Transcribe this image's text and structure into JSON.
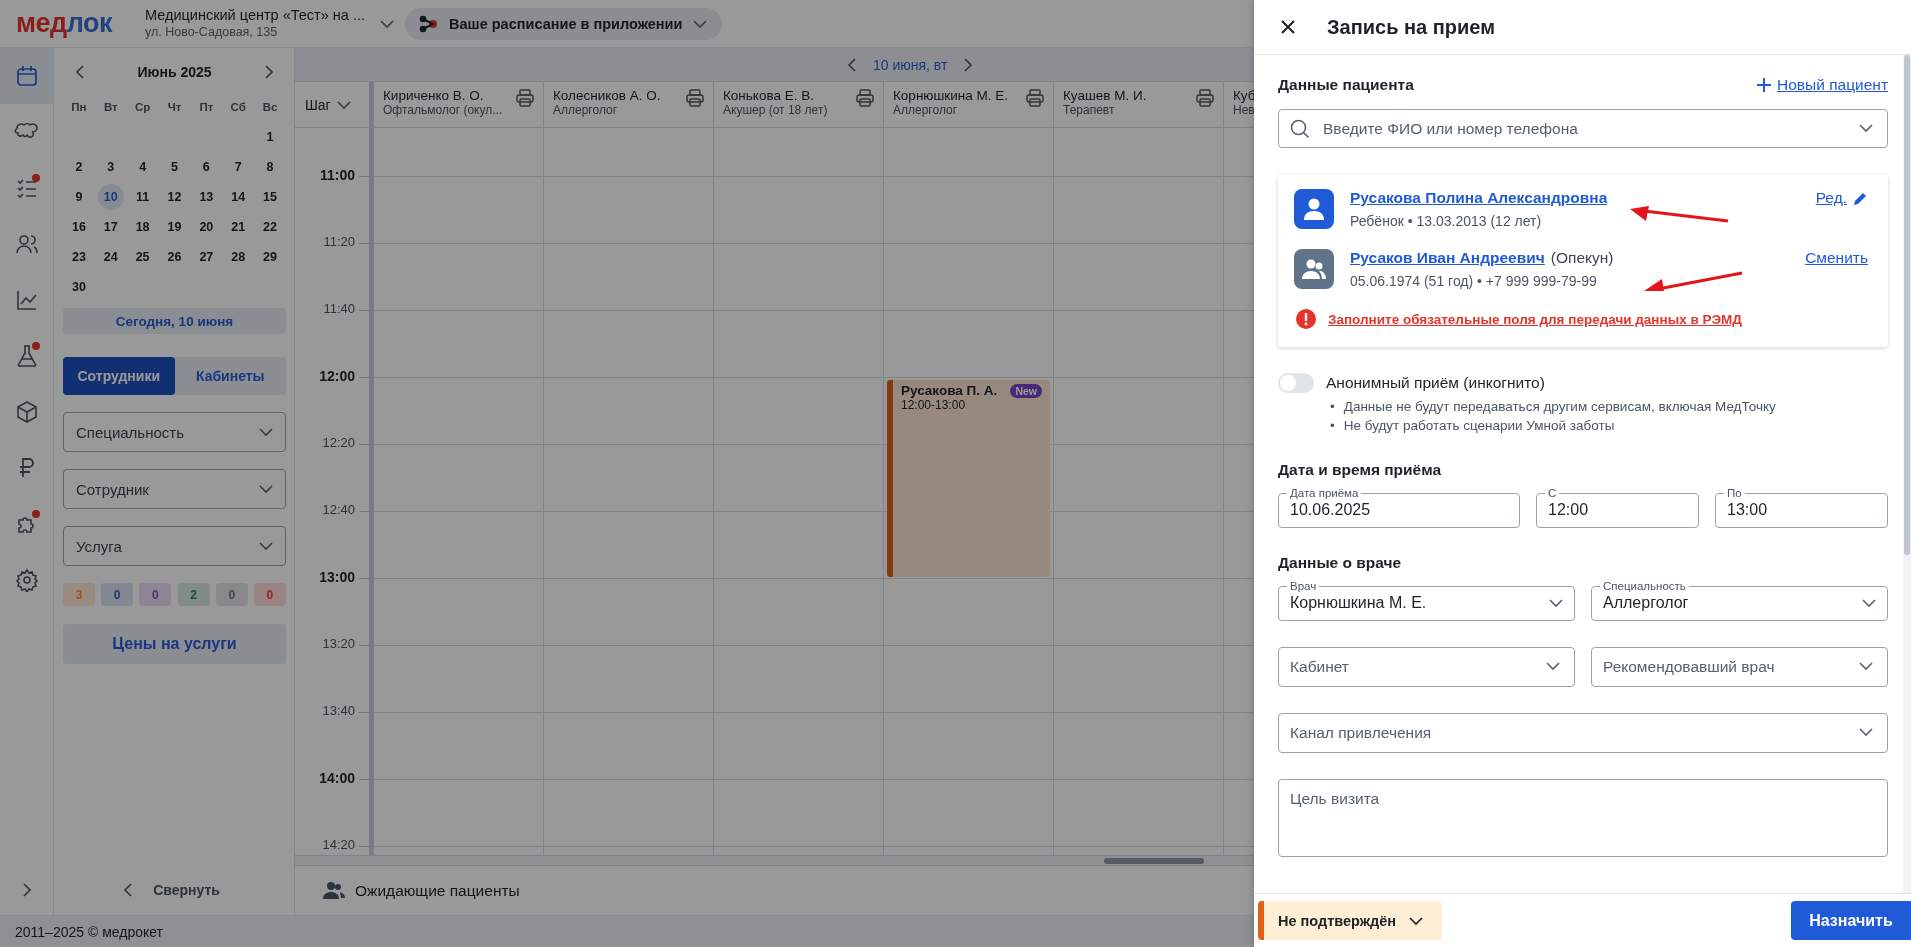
{
  "brand": {
    "logo_first": "мед",
    "logo_second": "лок"
  },
  "clinic": {
    "name": "Медицинский центр «Тест» на ...",
    "address": "ул. Ново-Садовая, 135"
  },
  "app_promo": "Ваше расписание в приложении",
  "rail": [
    {
      "kind": "calendar",
      "selected": true,
      "badge": false
    },
    {
      "kind": "teeth",
      "selected": false,
      "badge": false
    },
    {
      "kind": "checklist",
      "selected": false,
      "badge": true
    },
    {
      "kind": "users",
      "selected": false,
      "badge": false
    },
    {
      "kind": "chart",
      "selected": false,
      "badge": false
    },
    {
      "kind": "flask",
      "selected": false,
      "badge": true
    },
    {
      "kind": "box",
      "selected": false,
      "badge": false
    },
    {
      "kind": "ruble",
      "selected": false,
      "badge": false
    },
    {
      "kind": "puzzle",
      "selected": false,
      "badge": true
    },
    {
      "kind": "gear",
      "selected": false,
      "badge": false
    }
  ],
  "calendar": {
    "month": "Июнь 2025",
    "weekdays": [
      "Пн",
      "Вт",
      "Ср",
      "Чт",
      "Пт",
      "Сб",
      "Вс"
    ],
    "weeks": [
      {
        "kind": "tail",
        "days": [
          {
            "label": "1",
            "selected": false
          }
        ]
      },
      {
        "kind": "full",
        "days": [
          {
            "label": "2",
            "selected": false
          },
          {
            "label": "3",
            "selected": false
          },
          {
            "label": "4",
            "selected": false
          },
          {
            "label": "5",
            "selected": false
          },
          {
            "label": "6",
            "selected": false
          },
          {
            "label": "7",
            "selected": false
          },
          {
            "label": "8",
            "selected": false
          }
        ]
      },
      {
        "kind": "full",
        "days": [
          {
            "label": "9",
            "selected": false
          },
          {
            "label": "10",
            "selected": true
          },
          {
            "label": "11",
            "selected": false
          },
          {
            "label": "12",
            "selected": false
          },
          {
            "label": "13",
            "selected": false
          },
          {
            "label": "14",
            "selected": false
          },
          {
            "label": "15",
            "selected": false
          }
        ]
      },
      {
        "kind": "full",
        "days": [
          {
            "label": "16",
            "selected": false
          },
          {
            "label": "17",
            "selected": false
          },
          {
            "label": "18",
            "selected": false
          },
          {
            "label": "19",
            "selected": false
          },
          {
            "label": "20",
            "selected": false
          },
          {
            "label": "21",
            "selected": false
          },
          {
            "label": "22",
            "selected": false
          }
        ]
      },
      {
        "kind": "full",
        "days": [
          {
            "label": "23",
            "selected": false
          },
          {
            "label": "24",
            "selected": false
          },
          {
            "label": "25",
            "selected": false
          },
          {
            "label": "26",
            "selected": false
          },
          {
            "label": "27",
            "selected": false
          },
          {
            "label": "28",
            "selected": false
          },
          {
            "label": "29",
            "selected": false
          }
        ]
      },
      {
        "kind": "head",
        "days": [
          {
            "label": "30",
            "selected": false
          }
        ]
      }
    ]
  },
  "today_button": "Сегодня, 10 июня",
  "view_tabs": [
    {
      "label": "Сотрудники",
      "selected": true
    },
    {
      "label": "Кабинеты",
      "selected": false
    }
  ],
  "filters": [
    {
      "placeholder": "Специальность"
    },
    {
      "placeholder": "Сотрудник"
    },
    {
      "placeholder": "Услуга"
    }
  ],
  "counters": [
    {
      "value": "3",
      "color": "#a0501c"
    },
    {
      "value": "0",
      "color": "#1c3976"
    },
    {
      "value": "0",
      "color": "#532f7d"
    },
    {
      "value": "2",
      "color": "#13532e"
    },
    {
      "value": "0",
      "color": "#40444d"
    },
    {
      "value": "0",
      "color": "#9a2424"
    }
  ],
  "prices_button": "Цены на услуги",
  "collapse": "Свернуть",
  "footer": "2011–2025 © медрокет",
  "schedule": {
    "date": "10 июня, вт",
    "step": "Шаг",
    "doctors": [
      {
        "name": "Кириченко В. О.",
        "specialty": "Офтальмолог (окул...",
        "printer": true
      },
      {
        "name": "Колесников А. О.",
        "specialty": "Аллерголог",
        "printer": true
      },
      {
        "name": "Конькова Е. В.",
        "specialty": "Акушер (от 18 лет)",
        "printer": true
      },
      {
        "name": "Корнюшкина М. Е.",
        "specialty": "Аллерголог",
        "printer": true,
        "appointments": [
          {
            "patient": "Русакова П. А.",
            "time": "12:00-13:00",
            "badge": "New"
          }
        ]
      },
      {
        "name": "Куашев М. И.",
        "specialty": "Терапевт",
        "printer": true
      },
      {
        "name": "Куб",
        "specialty": "Нев"
      }
    ],
    "times": [
      {
        "label": "11:00",
        "major": true
      },
      {
        "label": "11:20",
        "major": false
      },
      {
        "label": "11:40",
        "major": false
      },
      {
        "label": "12:00",
        "major": true
      },
      {
        "label": "12:20",
        "major": false
      },
      {
        "label": "12:40",
        "major": false
      },
      {
        "label": "13:00",
        "major": true
      },
      {
        "label": "13:20",
        "major": false
      },
      {
        "label": "13:40",
        "major": false
      },
      {
        "label": "14:00",
        "major": true
      },
      {
        "label": "14:20",
        "major": false
      }
    ],
    "waiting": "Ожидающие пациенты"
  },
  "dialog": {
    "title": "Запись на прием",
    "patient_heading": "Данные пациента",
    "new_patient": "Новый пациент",
    "search_placeholder": "Введите ФИО или номер телефона",
    "patient": {
      "name": "Русакова Полина Александровна",
      "details": "Ребёнок • 13.03.2013 (12 лет)",
      "action": "Ред.",
      "arrow": true
    },
    "guardian": {
      "name": "Русаков Иван Андреевич",
      "role": "(Опекун)",
      "details": "05.06.1974 (51 год) • +7 999 999-79-99",
      "action": "Сменить",
      "arrow": true
    },
    "warning": "Заполните обязательные поля для передачи данных в РЭМД",
    "anonymous": {
      "label": "Анонимный приём (инкогнито)",
      "on": false,
      "note_marker": "•",
      "notes": [
        "Данные не будут передаваться другим сервисам, включая МедТочку",
        "Не будут работать сценарии Умной заботы"
      ]
    },
    "date_heading": "Дата и время приёма",
    "date_fields": [
      {
        "label": "Дата приёма",
        "value": "10.06.2025"
      },
      {
        "label": "С",
        "value": "12:00"
      },
      {
        "label": "По",
        "value": "13:00"
      }
    ],
    "doctor_heading": "Данные о враче",
    "doctor_fields": [
      {
        "label": "Врач",
        "value": "Корнюшкина М. Е.",
        "wide": false
      },
      {
        "label": "Специальность",
        "value": "Аллерголог",
        "wide": false
      },
      {
        "placeholder": "Кабинет",
        "wide": false
      },
      {
        "placeholder": "Рекомендовавший врач",
        "wide": false
      },
      {
        "placeholder": "Канал привлечения",
        "wide": true
      }
    ],
    "purpose_placeholder": "Цель визита",
    "status": "Не подтверждён",
    "submit": "Назначить"
  }
}
